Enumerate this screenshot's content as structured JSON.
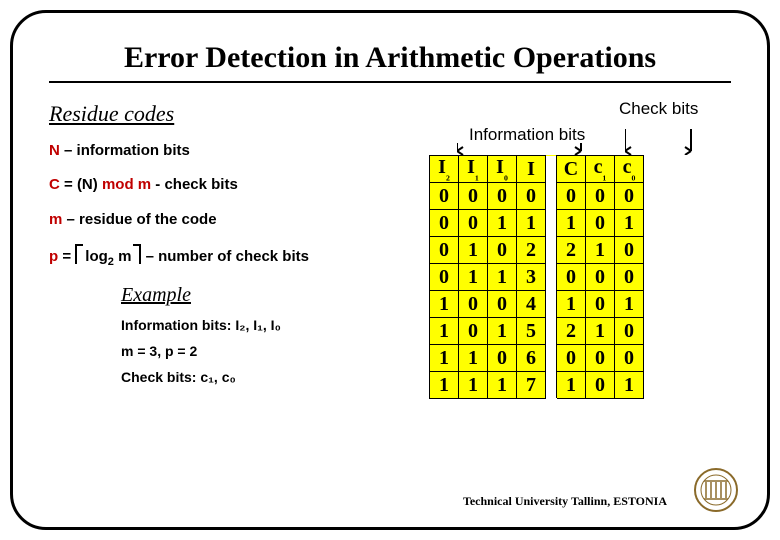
{
  "title": "Error Detection in Arithmetic Operations",
  "subtitle": "Residue codes",
  "labels": {
    "info_bits": "Information bits",
    "check_bits": "Check bits"
  },
  "defs": {
    "n_line": {
      "sym": "N",
      "rest": " – information bits"
    },
    "c_line": {
      "sym": "C",
      "rest1": " = (N) ",
      "mod": "mod m ",
      "rest2": " - check bits"
    },
    "m_line": {
      "sym": "m",
      "rest": " – residue of the code"
    },
    "p_line": {
      "sym": "p",
      "rest1": " = ",
      "log": "log",
      "base": "2",
      "arg": " m",
      "rest2": " – number of check bits"
    }
  },
  "example": {
    "title": "Example",
    "info_label": "Information bits: ",
    "info_bits": "I₂, I₁, I₀",
    "mp": "m = 3, p = 2",
    "check_label": "Check bits: ",
    "check_bits": "c₁, c₀"
  },
  "chart_data": {
    "type": "table",
    "title": "Residue code table (m=3, p=2)",
    "columns_info": [
      "I2",
      "I1",
      "I0",
      "I"
    ],
    "columns_check": [
      "C",
      "c1",
      "c0"
    ],
    "rows": [
      {
        "I2": 0,
        "I1": 0,
        "I0": 0,
        "I": 0,
        "C": 0,
        "c1": 0,
        "c0": 0
      },
      {
        "I2": 0,
        "I1": 0,
        "I0": 1,
        "I": 1,
        "C": 1,
        "c1": 0,
        "c0": 1
      },
      {
        "I2": 0,
        "I1": 1,
        "I0": 0,
        "I": 2,
        "C": 2,
        "c1": 1,
        "c0": 0
      },
      {
        "I2": 0,
        "I1": 1,
        "I0": 1,
        "I": 3,
        "C": 0,
        "c1": 0,
        "c0": 0
      },
      {
        "I2": 1,
        "I1": 0,
        "I0": 0,
        "I": 4,
        "C": 1,
        "c1": 0,
        "c0": 1
      },
      {
        "I2": 1,
        "I1": 0,
        "I0": 1,
        "I": 5,
        "C": 2,
        "c1": 1,
        "c0": 0
      },
      {
        "I2": 1,
        "I1": 1,
        "I0": 0,
        "I": 6,
        "C": 0,
        "c1": 0,
        "c0": 0
      },
      {
        "I2": 1,
        "I1": 1,
        "I0": 1,
        "I": 7,
        "C": 1,
        "c1": 0,
        "c0": 1
      }
    ],
    "display_headers": [
      "I₂",
      "I₁",
      "I₀",
      "I",
      "C",
      "c₁",
      "c₀"
    ]
  },
  "footer": "Technical University Tallinn, ESTONIA"
}
